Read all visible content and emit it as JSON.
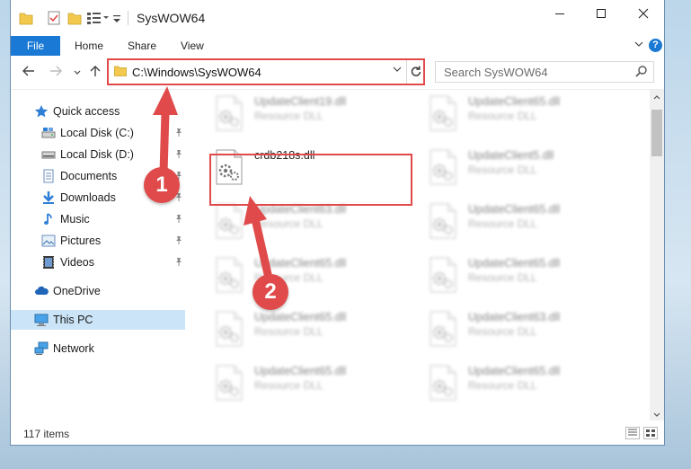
{
  "window": {
    "title": "SysWOW64"
  },
  "ribbon": {
    "tabs": [
      "File",
      "Home",
      "Share",
      "View"
    ],
    "help": "?"
  },
  "address": {
    "path": "C:\\Windows\\SysWOW64",
    "search_placeholder": "Search SysWOW64"
  },
  "nav": {
    "items": [
      {
        "label": "Quick access",
        "icon": "star-icon",
        "pinned": false
      },
      {
        "label": "Local Disk (C:)",
        "icon": "drive-icon",
        "pinned": true
      },
      {
        "label": "Local Disk (D:)",
        "icon": "drive-icon",
        "pinned": true
      },
      {
        "label": "Documents",
        "icon": "documents-icon",
        "pinned": true
      },
      {
        "label": "Downloads",
        "icon": "download-icon",
        "pinned": true
      },
      {
        "label": "Music",
        "icon": "music-icon",
        "pinned": true
      },
      {
        "label": "Pictures",
        "icon": "pictures-icon",
        "pinned": true
      },
      {
        "label": "Videos",
        "icon": "videos-icon",
        "pinned": true
      },
      {
        "label": "OneDrive",
        "icon": "cloud-icon",
        "pinned": false
      },
      {
        "label": "This PC",
        "icon": "computer-icon",
        "pinned": false,
        "selected": true
      },
      {
        "label": "Network",
        "icon": "network-icon",
        "pinned": false
      }
    ]
  },
  "files": {
    "left": [
      {
        "name": "UpdateClient19.dll",
        "type": "Resource DLL",
        "blurred": true
      },
      {
        "name": "crdb218s.dll",
        "type": "",
        "blurred": false,
        "highlighted": true
      },
      {
        "name": "UpdateClient63.dll",
        "type": "Resource DLL",
        "blurred": true
      },
      {
        "name": "UpdateClient65.dll",
        "type": "Resource DLL",
        "blurred": true
      },
      {
        "name": "UpdateClient65.dll",
        "type": "Resource DLL",
        "blurred": true
      },
      {
        "name": "UpdateClient65.dll",
        "type": "Resource DLL",
        "blurred": true
      }
    ],
    "right": [
      {
        "name": "UpdateClient65.dll",
        "type": "Resource DLL",
        "blurred": true
      },
      {
        "name": "UpdateClient5.dll",
        "type": "Resource DLL",
        "blurred": true
      },
      {
        "name": "UpdateClient65.dll",
        "type": "Resource DLL",
        "blurred": true
      },
      {
        "name": "UpdateClient65.dll",
        "type": "Resource DLL",
        "blurred": true
      },
      {
        "name": "UpdateClient63.dll",
        "type": "Resource DLL",
        "blurred": true
      },
      {
        "name": "UpdateClient65.dll",
        "type": "Resource DLL",
        "blurred": true
      }
    ]
  },
  "status": {
    "item_count": "117 items"
  },
  "annotations": {
    "step1": "1",
    "step2": "2",
    "color": "#e04a4a"
  },
  "colors": {
    "accent": "#1a79d4",
    "selected_bg": "#cce4f7"
  }
}
